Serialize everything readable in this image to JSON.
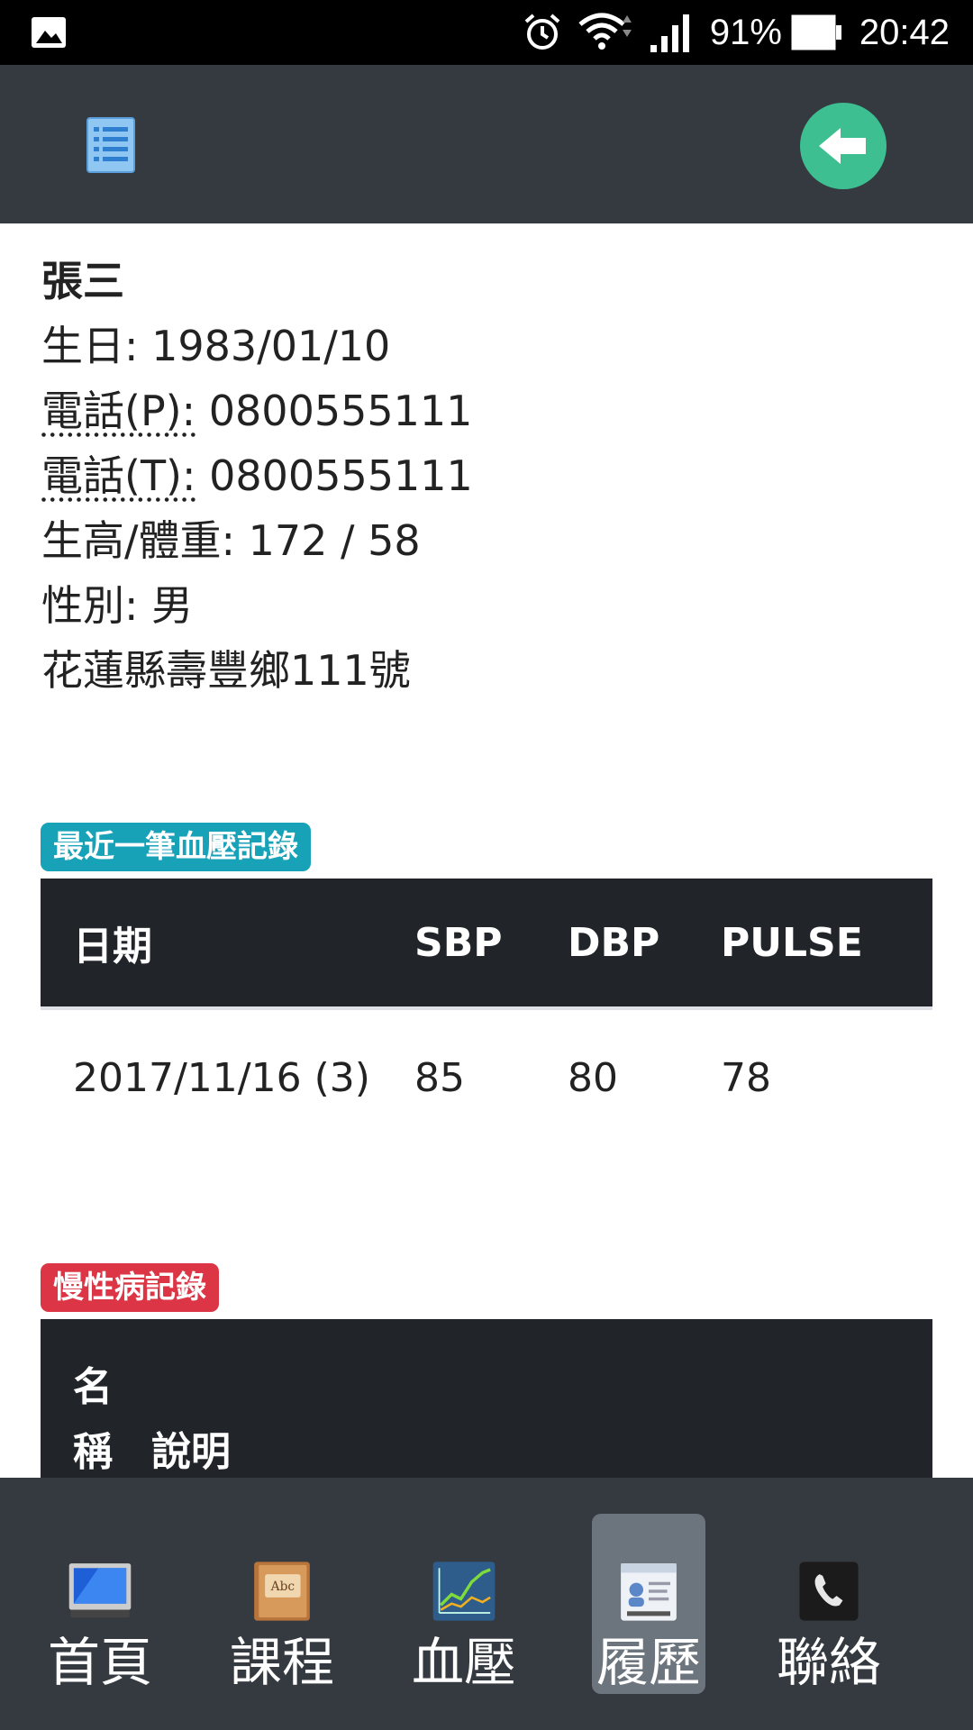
{
  "status_bar": {
    "battery_percent": "91%",
    "time": "20:42",
    "icons": [
      "gallery-icon",
      "alarm-icon",
      "wifi-icon",
      "signal-icon",
      "battery-icon"
    ]
  },
  "header": {
    "menu_icon": "list-icon",
    "back_icon": "arrow-left-icon",
    "colors": {
      "bar": "#343a40",
      "back_button": "#3dbf91"
    }
  },
  "profile": {
    "name": "張三",
    "birthday_label": "生日:",
    "birthday": "1983/01/10",
    "phone_p_label": "電話(P):",
    "phone_p": "0800555111",
    "phone_t_label": "電話(T):",
    "phone_t": "0800555111",
    "height_weight_label": "生高/體重:",
    "height_weight": "172 / 58",
    "gender_label": "性別:",
    "gender": "男",
    "address": "花蓮縣壽豐鄉111號"
  },
  "bp_section": {
    "badge": "最近一筆血壓記錄",
    "badge_color": "#17a2b8",
    "columns": [
      "日期",
      "SBP",
      "DBP",
      "PULSE"
    ],
    "rows": [
      [
        "2017/11/16 (3)",
        "85",
        "80",
        "78"
      ]
    ]
  },
  "chronic_section": {
    "badge": "慢性病記錄",
    "badge_color": "#dc3545",
    "col_name_line1": "名",
    "col_name_line2": "稱",
    "col_desc": "說明"
  },
  "bottom_nav": {
    "active_index": 3,
    "items": [
      {
        "label": "首頁",
        "icon": "monitor-icon"
      },
      {
        "label": "課程",
        "icon": "book-icon"
      },
      {
        "label": "血壓",
        "icon": "chart-icon"
      },
      {
        "label": "履歷",
        "icon": "id-card-icon"
      },
      {
        "label": "聯絡",
        "icon": "phone-icon"
      }
    ]
  }
}
